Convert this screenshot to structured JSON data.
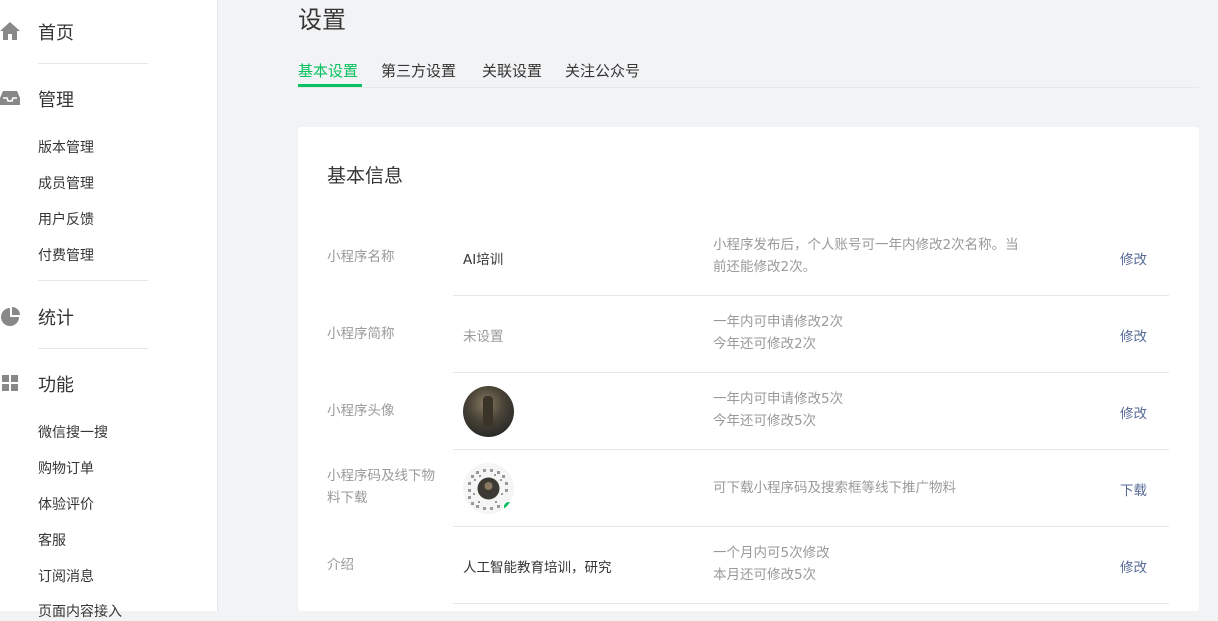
{
  "sidebar": {
    "home": "首页",
    "manage": {
      "title": "管理",
      "items": [
        "版本管理",
        "成员管理",
        "用户反馈",
        "付费管理"
      ]
    },
    "stats": "统计",
    "features": {
      "title": "功能",
      "items": [
        "微信搜一搜",
        "购物订单",
        "体验评价",
        "客服",
        "订阅消息",
        "页面内容接入"
      ]
    }
  },
  "page": {
    "title": "设置",
    "tabs": [
      "基本设置",
      "第三方设置",
      "关联设置",
      "关注公众号"
    ],
    "active_tab": "基本设置"
  },
  "card": {
    "title": "基本信息",
    "rows": [
      {
        "label": "小程序名称",
        "value": "AI培训",
        "tip_line1": "小程序发布后，个人账号可一年内修改2次名称。当",
        "tip_line2": "前还能修改2次。",
        "action": "修改"
      },
      {
        "label": "小程序简称",
        "value": "未设置",
        "tip_line1": "一年内可申请修改2次",
        "tip_line2": "今年还可修改2次",
        "action": "修改"
      },
      {
        "label": "小程序头像",
        "tip_line1": "一年内可申请修改5次",
        "tip_line2": "今年还可修改5次",
        "action": "修改"
      },
      {
        "label_line1": "小程序码及线下物",
        "label_line2": "料下载",
        "tip_line1": "可下载小程序码及搜索框等线下推广物料",
        "action": "下载"
      },
      {
        "label": "介绍",
        "value": "人工智能教育培训，研究",
        "tip_line1": "一个月内可5次修改",
        "tip_line2": "本月还可修改5次",
        "action": "修改"
      }
    ]
  },
  "colors": {
    "accent": "#07c160",
    "link": "#576b95",
    "muted": "#9a9a9a",
    "text": "#353535"
  }
}
